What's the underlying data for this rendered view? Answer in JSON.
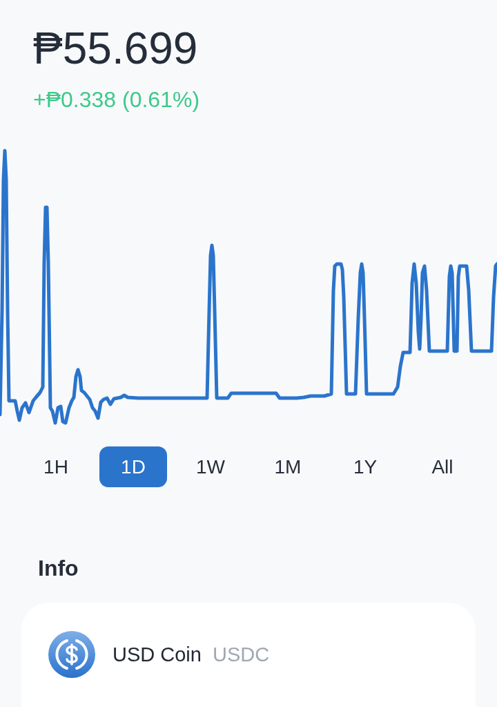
{
  "price": {
    "value": "₱55.699",
    "change": "+₱0.338 (0.61%)",
    "positive": true
  },
  "ranges": [
    {
      "label": "1H",
      "selected": false
    },
    {
      "label": "1D",
      "selected": true
    },
    {
      "label": "1W",
      "selected": false
    },
    {
      "label": "1M",
      "selected": false
    },
    {
      "label": "1Y",
      "selected": false
    },
    {
      "label": "All",
      "selected": false
    }
  ],
  "info": {
    "title": "Info",
    "asset": {
      "name": "USD Coin",
      "symbol": "USDC"
    }
  }
}
